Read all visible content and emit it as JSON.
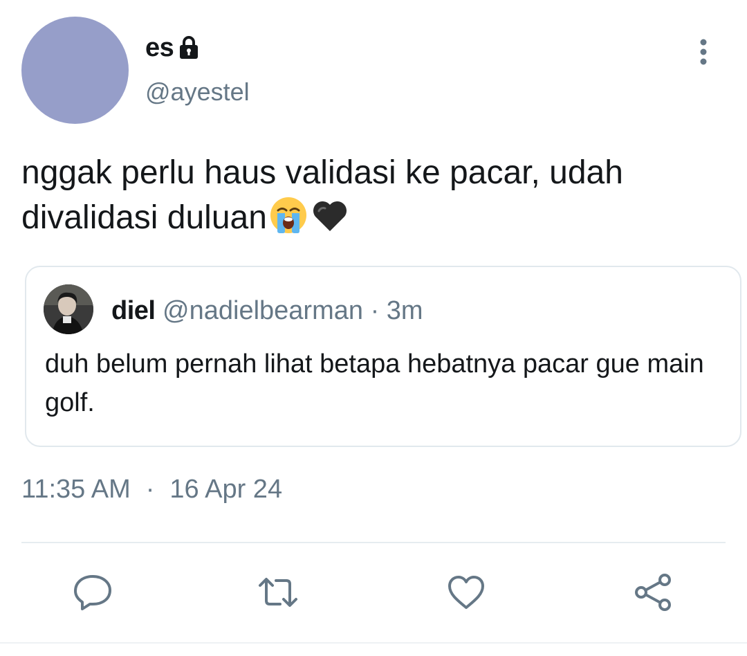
{
  "author": {
    "display_name": "es",
    "handle": "@ayestel",
    "avatar_color": "#969ec9",
    "protected_icon": "lock-icon"
  },
  "menu_icon": "more-vertical-icon",
  "tweet": {
    "text": "nggak perlu haus validasi ke pacar, udah divalidasi duluan",
    "emojis": [
      "loudly-crying-face",
      "black-heart"
    ]
  },
  "quote": {
    "display_name": "diel",
    "handle": "@nadielbearman",
    "separator": "·",
    "time": "3m",
    "text": "duh belum pernah lihat betapa hebatnya pacar gue main golf."
  },
  "meta": {
    "time": "11:35 AM",
    "separator": "·",
    "date": "16 Apr 24"
  },
  "actions": [
    {
      "icon": "reply-icon"
    },
    {
      "icon": "retweet-icon"
    },
    {
      "icon": "like-icon"
    },
    {
      "icon": "share-icon"
    }
  ],
  "colors": {
    "text": "#14171a",
    "secondary": "#657786",
    "border": "#e1e8ed"
  }
}
